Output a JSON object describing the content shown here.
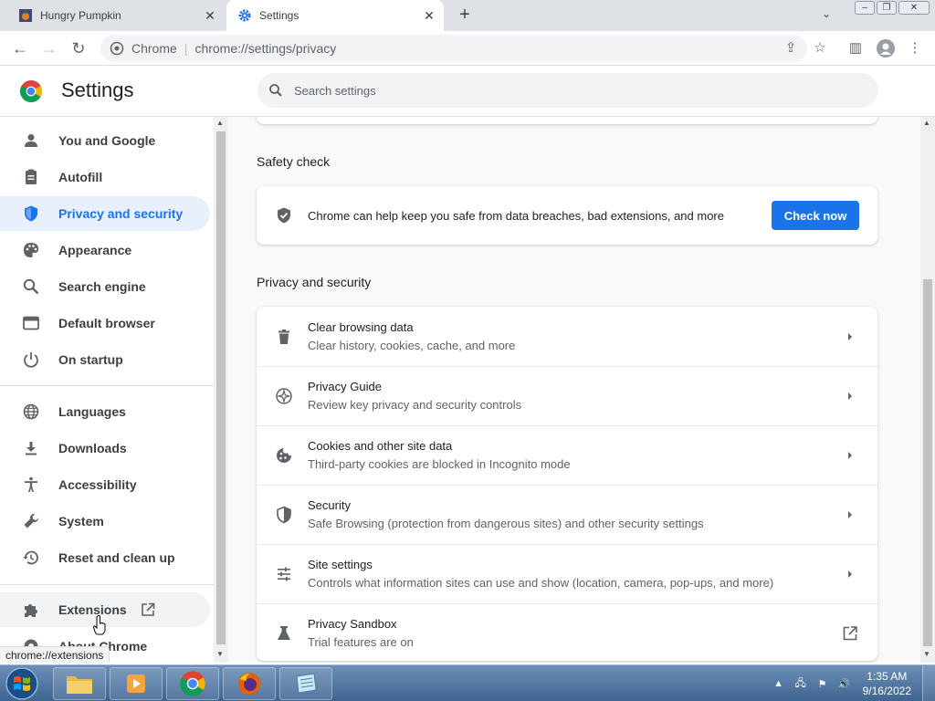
{
  "browser": {
    "tabs": [
      {
        "title": "Hungry Pumpkin",
        "favicon": "pumpkin-game-favicon"
      },
      {
        "title": "Settings",
        "favicon": "gear-icon",
        "active": true
      }
    ],
    "omnibox": {
      "chip": "Chrome",
      "url": "chrome://settings/privacy"
    },
    "status_bubble": "chrome://extensions"
  },
  "settings": {
    "title": "Settings",
    "search_placeholder": "Search settings",
    "sidebar": {
      "items": [
        {
          "label": "You and Google",
          "icon": "person-icon"
        },
        {
          "label": "Autofill",
          "icon": "clipboard-icon"
        },
        {
          "label": "Privacy and security",
          "icon": "shield-icon",
          "active": true
        },
        {
          "label": "Appearance",
          "icon": "palette-icon"
        },
        {
          "label": "Search engine",
          "icon": "search-icon"
        },
        {
          "label": "Default browser",
          "icon": "browser-window-icon"
        },
        {
          "label": "On startup",
          "icon": "power-icon"
        },
        {
          "label": "Languages",
          "icon": "globe-icon"
        },
        {
          "label": "Downloads",
          "icon": "download-icon"
        },
        {
          "label": "Accessibility",
          "icon": "accessibility-icon"
        },
        {
          "label": "System",
          "icon": "wrench-icon"
        },
        {
          "label": "Reset and clean up",
          "icon": "restore-icon"
        },
        {
          "label": "Extensions",
          "icon": "puzzle-icon"
        },
        {
          "label": "About Chrome",
          "icon": "chrome-icon"
        }
      ]
    },
    "safety_check": {
      "heading": "Safety check",
      "text": "Chrome can help keep you safe from data breaches, bad extensions, and more",
      "button": "Check now"
    },
    "privacy": {
      "heading": "Privacy and security",
      "rows": [
        {
          "label": "Clear browsing data",
          "sub": "Clear history, cookies, cache, and more",
          "icon": "trash-icon"
        },
        {
          "label": "Privacy Guide",
          "sub": "Review key privacy and security controls",
          "icon": "compass-icon"
        },
        {
          "label": "Cookies and other site data",
          "sub": "Third-party cookies are blocked in Incognito mode",
          "icon": "cookie-icon"
        },
        {
          "label": "Security",
          "sub": "Safe Browsing (protection from dangerous sites) and other security settings",
          "icon": "shield-icon"
        },
        {
          "label": "Site settings",
          "sub": "Controls what information sites can use and show (location, camera, pop-ups, and more)",
          "icon": "sliders-icon"
        },
        {
          "label": "Privacy Sandbox",
          "sub": "Trial features are on",
          "icon": "flask-icon"
        }
      ]
    }
  },
  "taskbar": {
    "time": "1:35 AM",
    "date": "9/16/2022"
  },
  "colors": {
    "accent": "#1a73e8",
    "active_bg": "#e8f0fe"
  }
}
